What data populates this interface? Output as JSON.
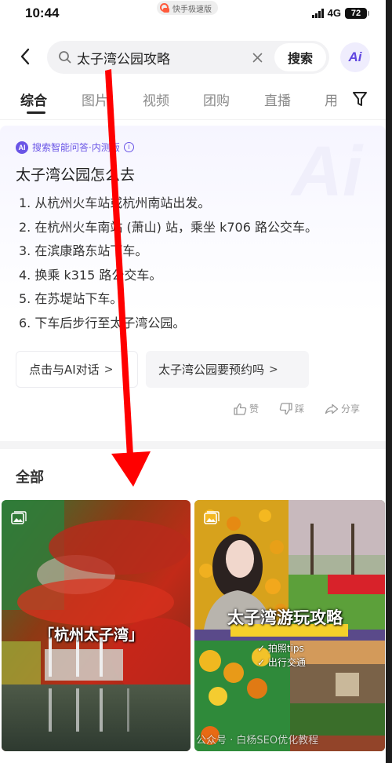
{
  "status_bar": {
    "time": "10:44",
    "app_pill": "快手极速版",
    "network": "4G",
    "battery": "72"
  },
  "search": {
    "query": "太子湾公园攻略",
    "placeholder": "",
    "search_button": "搜索",
    "ai_button": "Ai",
    "icons": {
      "back": "chevron-left-icon",
      "search": "magnifier-icon",
      "clear": "close-icon",
      "filter": "funnel-icon"
    }
  },
  "tabs": [
    {
      "label": "综合",
      "active": true
    },
    {
      "label": "图片",
      "active": false
    },
    {
      "label": "视频",
      "active": false
    },
    {
      "label": "团购",
      "active": false
    },
    {
      "label": "直播",
      "active": false
    },
    {
      "label": "用",
      "active": false
    }
  ],
  "ai_answer": {
    "badge": "AI",
    "label": "搜索智能问答·内测版",
    "question": "太子湾公园怎么去",
    "steps": [
      "1. 从杭州火车站或杭州南站出发。",
      "2. 在杭州火车南站 (萧山) 站，乘坐 k706 路公交车。",
      "3. 在滨康路东站下车。",
      "4. 换乘 k315 路公交车。",
      "5. 在苏堤站下车。",
      "6. 下车后步行至太子湾公园。"
    ],
    "chips": [
      {
        "label": "点击与AI对话",
        "arrow": ">"
      },
      {
        "label": "太子湾公园要预约吗",
        "arrow": ">"
      }
    ],
    "feedback": {
      "like": "赞",
      "dislike": "踩",
      "share": "分享"
    },
    "accent_color": "#6a55e6"
  },
  "results": {
    "section_title": "全部",
    "cards": [
      {
        "type": "image",
        "caption": "「杭州太子湾」"
      },
      {
        "type": "image",
        "caption": "太子湾游玩攻略",
        "tips": [
          "拍照tips",
          "出行交通"
        ],
        "watermark": "公众号 · 白杨SEO优化教程"
      }
    ]
  }
}
